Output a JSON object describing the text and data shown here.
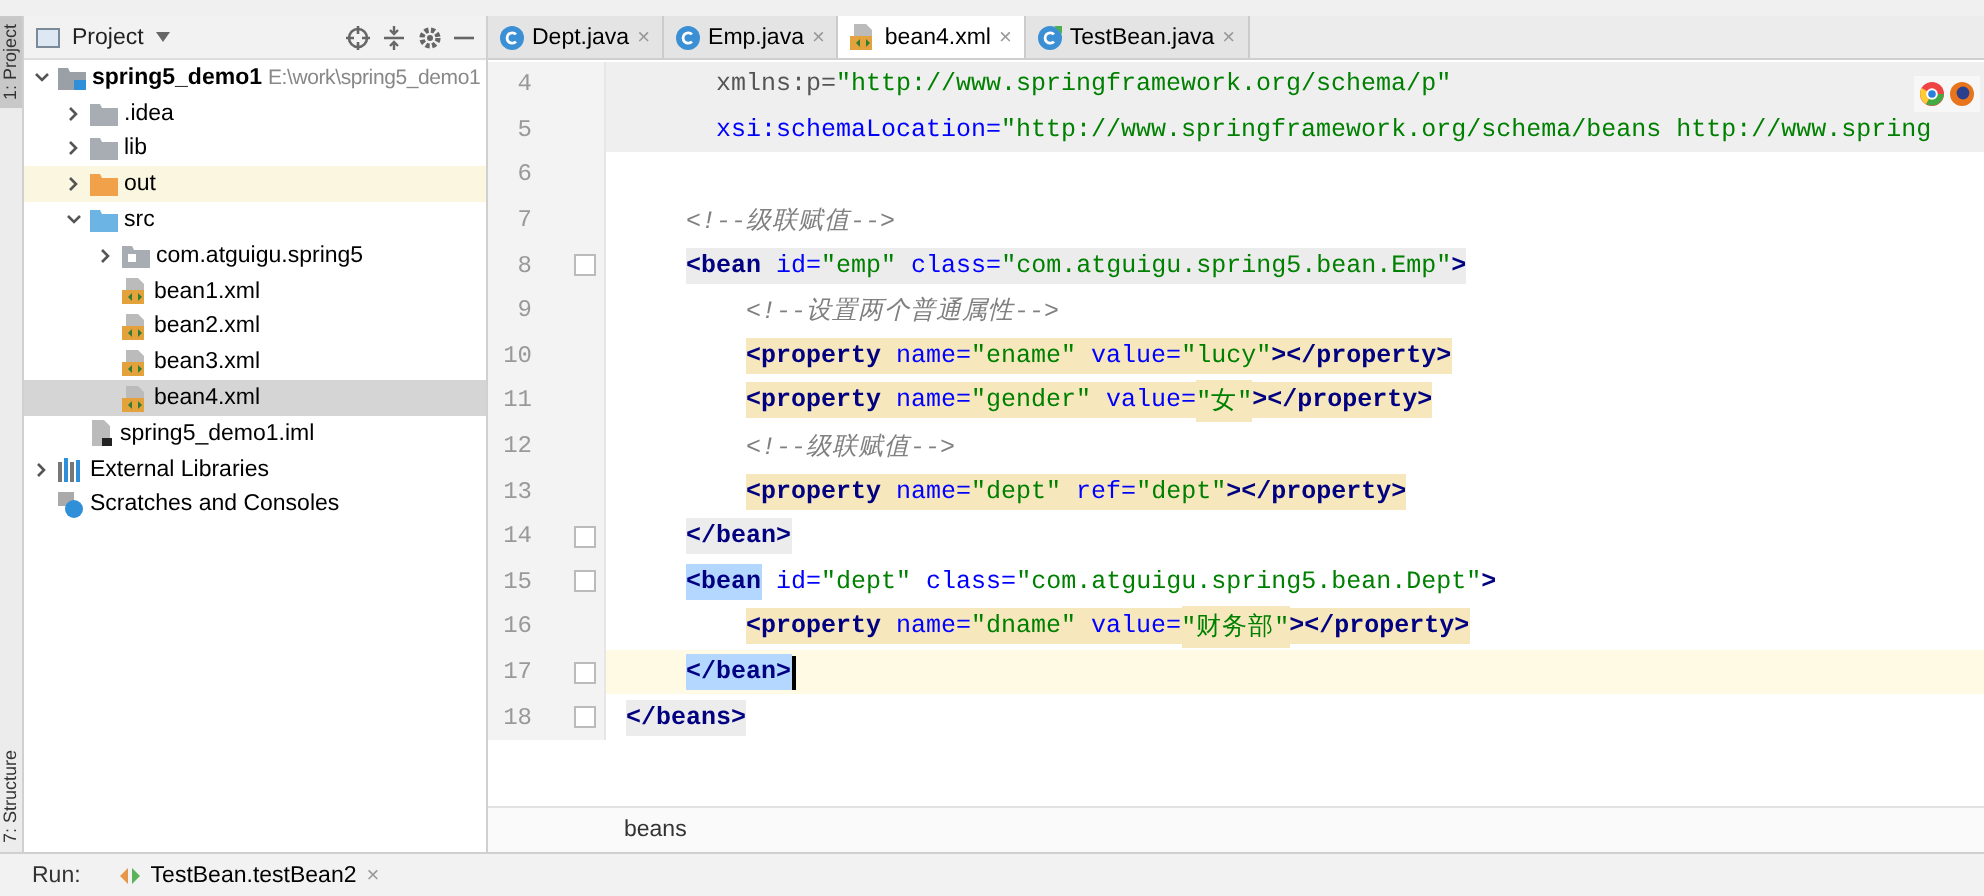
{
  "side_tabs": [
    {
      "label": "1: Project",
      "selected": true
    },
    {
      "label": "7: Structure",
      "selected": false
    }
  ],
  "project": {
    "title": "Project",
    "tree": [
      {
        "label": "spring5_demo1",
        "path": "E:\\work\\spring5_demo1",
        "kind": "module",
        "expanded": true,
        "selected": false,
        "children": [
          {
            "label": ".idea",
            "kind": "folder",
            "expanded": false,
            "selected": false
          },
          {
            "label": "lib",
            "kind": "folder",
            "expanded": false,
            "selected": false
          },
          {
            "label": "out",
            "kind": "excluded",
            "expanded": false,
            "selected": false
          },
          {
            "label": "src",
            "kind": "source",
            "expanded": true,
            "selected": false,
            "children": [
              {
                "label": "com.atguigu.spring5",
                "kind": "package",
                "expanded": false,
                "selected": false
              },
              {
                "label": "bean1.xml",
                "kind": "xml",
                "selected": false
              },
              {
                "label": "bean2.xml",
                "kind": "xml",
                "selected": false
              },
              {
                "label": "bean3.xml",
                "kind": "xml",
                "selected": false
              },
              {
                "label": "bean4.xml",
                "kind": "xml",
                "selected": true
              }
            ]
          },
          {
            "label": "spring5_demo1.iml",
            "kind": "iml",
            "selected": false
          }
        ]
      },
      {
        "label": "External Libraries",
        "kind": "libraries",
        "expanded": false,
        "selected": false
      },
      {
        "label": "Scratches and Consoles",
        "kind": "scratches",
        "selected": false
      }
    ]
  },
  "tabs": [
    {
      "label": "Dept.java",
      "kind": "class",
      "selected": false,
      "close": "×"
    },
    {
      "label": "Emp.java",
      "kind": "class",
      "selected": false,
      "close": "×"
    },
    {
      "label": "bean4.xml",
      "kind": "xml",
      "selected": true,
      "close": "×"
    },
    {
      "label": "TestBean.java",
      "kind": "test",
      "selected": false,
      "close": "×"
    }
  ],
  "editor": {
    "lines": [
      {
        "number": "4",
        "kind": "header",
        "fold": false,
        "current": false,
        "tokens": [
          {
            "kind": "ns",
            "text": "xmlns:p="
          },
          {
            "kind": "val",
            "text": "\"http://www.springframework.org/schema/p\""
          }
        ]
      },
      {
        "number": "5",
        "kind": "header",
        "fold": false,
        "current": false,
        "tokens": [
          {
            "kind": "attr",
            "text": "xsi:schemaLocation="
          },
          {
            "kind": "val",
            "text": "\"http://www.springframework.org/schema/beans http://www.spring"
          }
        ]
      },
      {
        "number": "6",
        "kind": "blank",
        "fold": false,
        "current": false
      },
      {
        "number": "7",
        "kind": "plain",
        "fold": false,
        "current": false,
        "tokens": [
          {
            "kind": "comment",
            "text": "<!--级联赋值-->"
          }
        ]
      },
      {
        "number": "8",
        "kind": "tag",
        "fold": true,
        "current": false,
        "tokens": [
          {
            "kind": "tag",
            "text": "<bean "
          },
          {
            "kind": "attr",
            "text": "id="
          },
          {
            "kind": "val",
            "text": "\"emp\" "
          },
          {
            "kind": "attr",
            "text": "class="
          },
          {
            "kind": "val",
            "text": "\"com.atguigu.spring5.bean.Emp\""
          },
          {
            "kind": "tag",
            "text": ">"
          }
        ],
        "children": [
          {
            "number": "9",
            "kind": "plain",
            "fold": false,
            "current": false,
            "tokens": [
              {
                "kind": "comment",
                "text": "<!--设置两个普通属性-->"
              }
            ]
          },
          {
            "number": "10",
            "kind": "property",
            "fold": false,
            "current": false,
            "tokens": [
              {
                "kind": "tag",
                "text": "<property "
              },
              {
                "kind": "attr",
                "text": "name="
              },
              {
                "kind": "val",
                "text": "\"ename\" "
              },
              {
                "kind": "attr",
                "text": "value="
              },
              {
                "kind": "val",
                "text": "\"lucy\""
              },
              {
                "kind": "tag",
                "text": "></property>"
              }
            ]
          },
          {
            "number": "11",
            "kind": "property",
            "fold": false,
            "current": false,
            "tokens": [
              {
                "kind": "tag",
                "text": "<property "
              },
              {
                "kind": "attr",
                "text": "name="
              },
              {
                "kind": "val",
                "text": "\"gender\" "
              },
              {
                "kind": "attr",
                "text": "value="
              },
              {
                "kind": "val",
                "text": "\"女\""
              },
              {
                "kind": "tag",
                "text": "></property>"
              }
            ]
          },
          {
            "number": "12",
            "kind": "plain",
            "fold": false,
            "current": false,
            "tokens": [
              {
                "kind": "comment",
                "text": "<!--级联赋值-->"
              }
            ]
          },
          {
            "number": "13",
            "kind": "property",
            "fold": false,
            "current": false,
            "tokens": [
              {
                "kind": "tag",
                "text": "<property "
              },
              {
                "kind": "attr",
                "text": "name="
              },
              {
                "kind": "val",
                "text": "\"dept\" "
              },
              {
                "kind": "attr",
                "text": "ref="
              },
              {
                "kind": "val",
                "text": "\"dept\""
              },
              {
                "kind": "tag",
                "text": "></property>"
              }
            ]
          }
        ]
      },
      {
        "number": "14",
        "kind": "tag",
        "fold": true,
        "current": false,
        "tokens": [
          {
            "kind": "tag",
            "text": "</bean>"
          }
        ]
      },
      {
        "number": "15",
        "kind": "match",
        "fold": true,
        "current": false,
        "tokens": [
          {
            "kind": "tag",
            "text": "<bean"
          },
          {
            "kind": "attr",
            "text": " id="
          },
          {
            "kind": "val",
            "text": "\"dept\" "
          },
          {
            "kind": "attr",
            "text": "class="
          },
          {
            "kind": "val",
            "text": "\"com.atguigu.spring5.bean.Dept\""
          },
          {
            "kind": "tag",
            "text": ">"
          }
        ],
        "children": [
          {
            "number": "16",
            "kind": "property",
            "fold": false,
            "current": false,
            "tokens": [
              {
                "kind": "tag",
                "text": "<property "
              },
              {
                "kind": "attr",
                "text": "name="
              },
              {
                "kind": "val",
                "text": "\"dname\" "
              },
              {
                "kind": "attr",
                "text": "value="
              },
              {
                "kind": "val",
                "text": "\"财务部\""
              },
              {
                "kind": "tag",
                "text": "></property>"
              }
            ]
          }
        ]
      },
      {
        "number": "17",
        "kind": "match",
        "fold": true,
        "current": true,
        "tokens": [
          {
            "kind": "tag",
            "text": "</bean>"
          }
        ]
      },
      {
        "number": "18",
        "kind": "root",
        "fold": true,
        "current": false,
        "tokens": [
          {
            "kind": "tag",
            "text": "</beans>"
          }
        ]
      }
    ],
    "breadcrumb": "beans"
  },
  "run_bar": {
    "label": "Run:",
    "tab": "TestBean.testBean2",
    "close": "×"
  }
}
